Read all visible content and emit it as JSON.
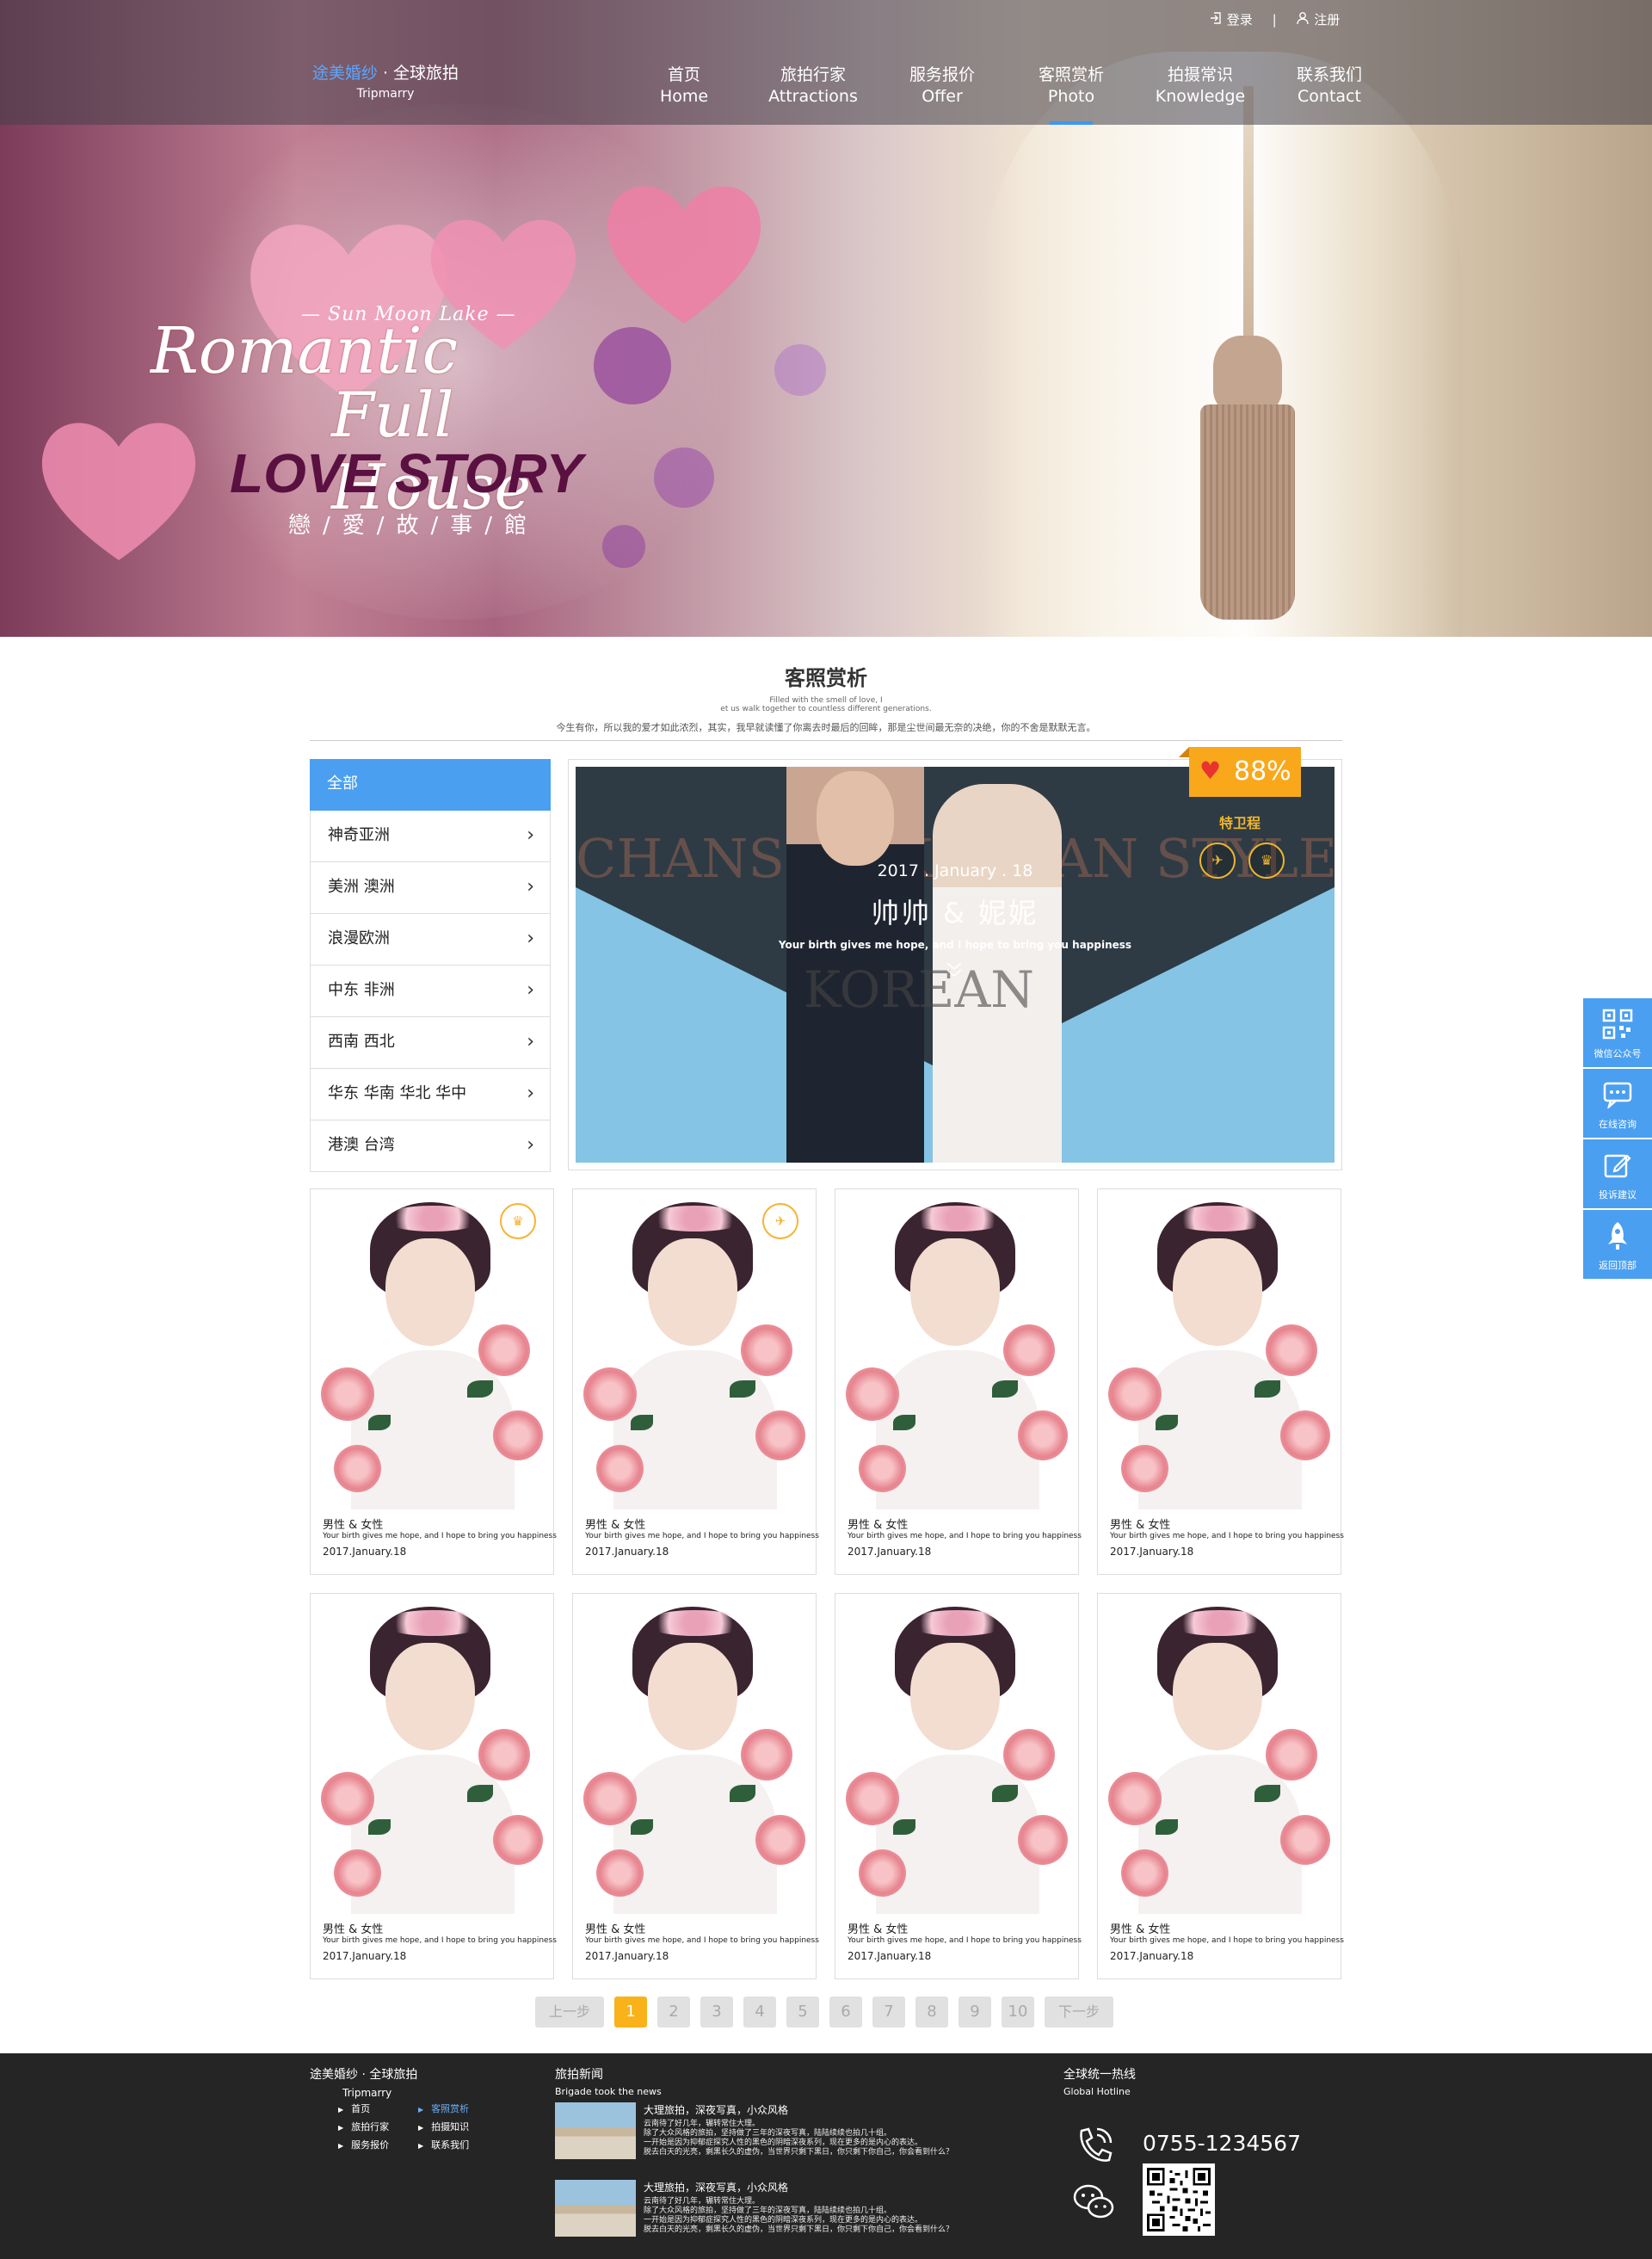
{
  "header": {
    "logo": {
      "brand_highlight": "途美婚纱",
      "brand_rest": " · 全球旅拍",
      "subtitle": "Tripmarry"
    },
    "account": {
      "login": "登录",
      "register": "注册"
    },
    "nav": [
      {
        "cn": "首页",
        "en": "Home"
      },
      {
        "cn": "旅拍行家",
        "en": "Attractions"
      },
      {
        "cn": "服务报价",
        "en": "Offer"
      },
      {
        "cn": "客照赏析",
        "en": "Photo",
        "active": true
      },
      {
        "cn": "拍摄常识",
        "en": "Knowledge"
      },
      {
        "cn": "联系我们",
        "en": "Contact"
      }
    ]
  },
  "hero": {
    "sub": "— Sun Moon Lake —",
    "line1": "Romantic",
    "line2": "Full House",
    "line3": "LOVE STORY",
    "line4": "戀/愛/故/事/館"
  },
  "section": {
    "title": "客照赏析",
    "en1": "Filled with the smell of love, I",
    "en2": "et us walk together to countless different generations.",
    "desc": "今生有你，所以我的爱才如此浓烈，其实，我早就读懂了你离去时最后的回眸，那是尘世间最无奈的决绝，你的不舍是默默无言。"
  },
  "categories": [
    "全部",
    "神奇亚洲",
    "美洲 澳洲",
    "浪漫欧洲",
    "中东 非洲",
    "西南 西北",
    "华东 华南 华北 华中",
    "港澳 台湾"
  ],
  "featured": {
    "badge": "88%",
    "ghost_text": "CHANSON KOREAN STYLE",
    "ghost_text2": "KOREAN",
    "brand": "特卫程",
    "date": "2017 . January . 18",
    "names": "帅帅 & 妮妮",
    "tagline": "Your birth gives me hope, and I hope to bring you happiness",
    "icons": [
      "drone-icon",
      "shoe-icon"
    ]
  },
  "cards": [
    {
      "title": "男性 & 女性",
      "desc": "Your birth gives me hope, and I hope to bring you happiness",
      "date": "2017.January.18",
      "icon": "shoe-icon"
    },
    {
      "title": "男性 & 女性",
      "desc": "Your birth gives me hope, and I hope to bring you happiness",
      "date": "2017.January.18",
      "icon": "drone-icon"
    },
    {
      "title": "男性 & 女性",
      "desc": "Your birth gives me hope, and I hope to bring you happiness",
      "date": "2017.January.18"
    },
    {
      "title": "男性 & 女性",
      "desc": "Your birth gives me hope, and I hope to bring you happiness",
      "date": "2017.January.18"
    },
    {
      "title": "男性 & 女性",
      "desc": "Your birth gives me hope, and I hope to bring you happiness",
      "date": "2017.January.18"
    },
    {
      "title": "男性 & 女性",
      "desc": "Your birth gives me hope, and I hope to bring you happiness",
      "date": "2017.January.18"
    },
    {
      "title": "男性 & 女性",
      "desc": "Your birth gives me hope, and I hope to bring you happiness",
      "date": "2017.January.18"
    },
    {
      "title": "男性 & 女性",
      "desc": "Your birth gives me hope, and I hope to bring you happiness",
      "date": "2017.January.18"
    }
  ],
  "pagination": {
    "prev": "上一步",
    "pages": [
      "1",
      "2",
      "3",
      "4",
      "5",
      "6",
      "7",
      "8",
      "9",
      "10"
    ],
    "current": "1",
    "next": "下一步"
  },
  "footer": {
    "logo": "途美婚纱 · 全球旅拍",
    "logo_sub": "Tripmarry",
    "links": [
      {
        "label": "首页"
      },
      {
        "label": "客照赏析",
        "active": true
      },
      {
        "label": "旅拍行家"
      },
      {
        "label": "拍摄知识"
      },
      {
        "label": "服务报价"
      },
      {
        "label": "联系我们"
      }
    ],
    "news_title": "旅拍新闻",
    "news_sub": "Brigade took the news",
    "news": [
      {
        "title": "大理旅拍，深夜写真，小众风格",
        "body": "云南待了好几年，辗转常住大理。\n除了大众风格的旅拍，坚持做了三年的深夜写真，陆陆续续也拍几十组。\n一开始是因为抑郁症探究人性的黑色的阴暗深夜系列，现在更多的是内心的表达。\n脱去白天的光亮，剩黑长久的虚伪，当世界只剩下黑日，你只剩下你自己，你会看到什么？"
      },
      {
        "title": "大理旅拍，深夜写真，小众风格",
        "body": "云南待了好几年，辗转常住大理。\n除了大众风格的旅拍，坚持做了三年的深夜写真，陆陆续续也拍几十组。\n一开始是因为抑郁症探究人性的黑色的阴暗深夜系列，现在更多的是内心的表达。\n脱去白天的光亮，剩黑长久的虚伪，当世界只剩下黑日，你只剩下你自己，你会看到什么？"
      }
    ],
    "hotline_title": "全球统一热线",
    "hotline_sub": "Global Hotline",
    "phone": "0755-1234567"
  },
  "sidetools": [
    {
      "label": "微信公众号",
      "icon": "qrcode-icon"
    },
    {
      "label": "在线咨询",
      "icon": "chat-icon"
    },
    {
      "label": "投诉建议",
      "icon": "edit-icon"
    },
    {
      "label": "返回顶部",
      "icon": "rocket-icon"
    }
  ],
  "colors": {
    "accent": "#4a9ff0",
    "badge": "#f9a81c",
    "pager_active": "#f9b21a",
    "footer_bg": "#252525"
  }
}
